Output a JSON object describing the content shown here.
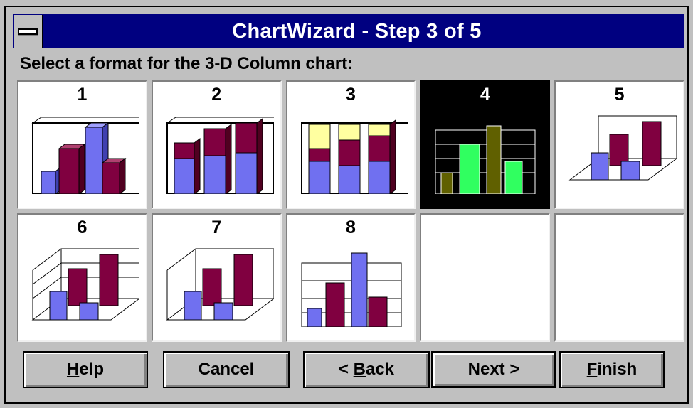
{
  "window": {
    "title": "ChartWizard - Step 3 of 5"
  },
  "prompt": "Select a format for the 3-D Column chart:",
  "formats": [
    "1",
    "2",
    "3",
    "4",
    "5",
    "6",
    "7",
    "8"
  ],
  "selected_format": "4",
  "buttons": {
    "help": {
      "accel": "H",
      "rest": "elp"
    },
    "cancel": "Cancel",
    "back": {
      "pre": "< ",
      "accel": "B",
      "rest": "ack"
    },
    "next": "Next >",
    "finish": {
      "accel": "F",
      "rest": "inish"
    }
  },
  "colors": {
    "title_bar": "#000080",
    "bar_blue": "#7070f0",
    "bar_maroon": "#800040",
    "bar_yellow": "#ffffa0",
    "bar_olive": "#606000",
    "bar_green": "#30ff60"
  }
}
